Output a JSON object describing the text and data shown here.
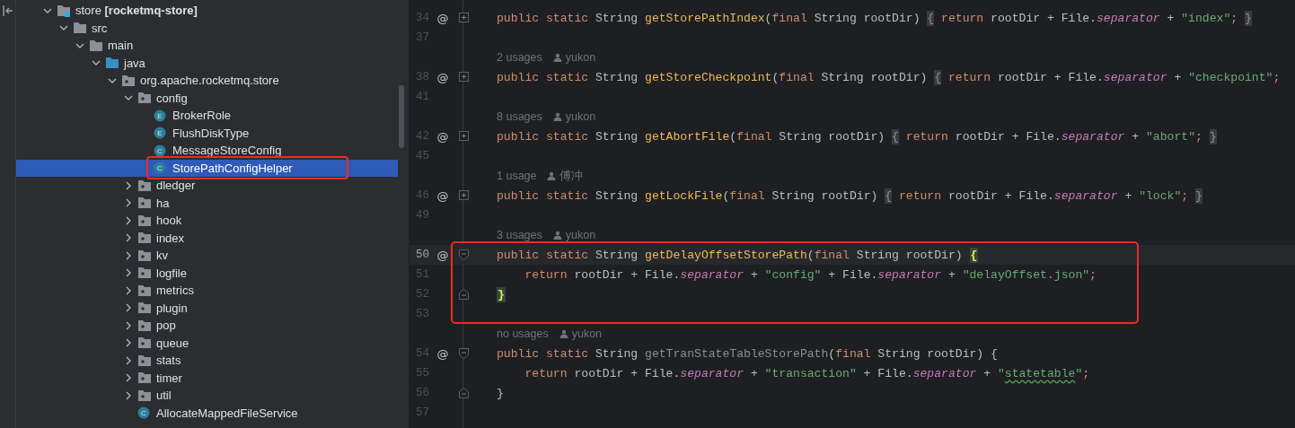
{
  "project_tree": {
    "items": [
      {
        "label": "store **[rocketmq-store]**",
        "kind": "module",
        "expanded": true,
        "selected": false,
        "children": [
          {
            "label": "src",
            "kind": "folder",
            "expanded": true,
            "selected": false,
            "children": [
              {
                "label": "main",
                "kind": "folder",
                "expanded": true,
                "selected": false,
                "children": [
                  {
                    "label": "java",
                    "kind": "source-folder",
                    "expanded": true,
                    "selected": false,
                    "children": [
                      {
                        "label": "org.apache.rocketmq.store",
                        "kind": "package",
                        "expanded": true,
                        "selected": false,
                        "children": [
                          {
                            "label": "config",
                            "kind": "package",
                            "expanded": true,
                            "selected": false,
                            "children": [
                              {
                                "label": "BrokerRole",
                                "icon_letter": "E",
                                "selected": false
                              },
                              {
                                "label": "FlushDiskType",
                                "icon_letter": "E",
                                "selected": false
                              },
                              {
                                "label": "MessageStoreConfig",
                                "icon_letter": "C",
                                "selected": false
                              },
                              {
                                "label": "StorePathConfigHelper",
                                "icon_letter": "C",
                                "selected": true,
                                "annotated": true
                              }
                            ]
                          },
                          {
                            "label": "dledger",
                            "kind": "package",
                            "expanded": false,
                            "selected": false
                          },
                          {
                            "label": "ha",
                            "kind": "package",
                            "expanded": false,
                            "selected": false
                          },
                          {
                            "label": "hook",
                            "kind": "package",
                            "expanded": false,
                            "selected": false
                          },
                          {
                            "label": "index",
                            "kind": "package",
                            "expanded": false,
                            "selected": false
                          },
                          {
                            "label": "kv",
                            "kind": "package",
                            "expanded": false,
                            "selected": false
                          },
                          {
                            "label": "logfile",
                            "kind": "package",
                            "expanded": false,
                            "selected": false
                          },
                          {
                            "label": "metrics",
                            "kind": "package",
                            "expanded": false,
                            "selected": false
                          },
                          {
                            "label": "plugin",
                            "kind": "package",
                            "expanded": false,
                            "selected": false
                          },
                          {
                            "label": "pop",
                            "kind": "package",
                            "expanded": false,
                            "selected": false
                          },
                          {
                            "label": "queue",
                            "kind": "package",
                            "expanded": false,
                            "selected": false
                          },
                          {
                            "label": "stats",
                            "kind": "package",
                            "expanded": false,
                            "selected": false
                          },
                          {
                            "label": "timer",
                            "kind": "package",
                            "expanded": false,
                            "selected": false
                          },
                          {
                            "label": "util",
                            "kind": "package",
                            "expanded": false,
                            "selected": false
                          },
                          {
                            "label": "AllocateMappedFileService",
                            "icon_letter": "C",
                            "selected": false
                          }
                        ]
                      }
                    ]
                  }
                ]
              }
            ]
          }
        ]
      }
    ]
  },
  "editor": {
    "lines": [
      {
        "kind": "line",
        "number": "34",
        "gutter_icon": "@",
        "folded": true,
        "tokens": [
          {
            "text": "public static ",
            "kind": "keyword"
          },
          {
            "text": "String ",
            "kind": "plain"
          },
          {
            "text": "getStorePathIndex",
            "kind": "method"
          },
          {
            "text": "(",
            "kind": "plain"
          },
          {
            "text": "final ",
            "kind": "keyword"
          },
          {
            "text": "String rootDir) ",
            "kind": "plain"
          },
          {
            "text": "{",
            "kind": "fold"
          },
          {
            "text": " return ",
            "kind": "keyword"
          },
          {
            "text": "rootDir + File.",
            "kind": "plain"
          },
          {
            "text": "separator",
            "kind": "field"
          },
          {
            "text": " + ",
            "kind": "plain"
          },
          {
            "text": "\"index\"",
            "kind": "string"
          },
          {
            "text": "; ",
            "kind": "punct"
          },
          {
            "text": "}",
            "kind": "fold"
          }
        ]
      },
      {
        "kind": "line",
        "number": "37"
      },
      {
        "kind": "hint",
        "usages": "2 usages",
        "author": "yukon"
      },
      {
        "kind": "line",
        "number": "38",
        "gutter_icon": "@",
        "folded": true,
        "tokens": [
          {
            "text": "public static ",
            "kind": "keyword"
          },
          {
            "text": "String ",
            "kind": "plain"
          },
          {
            "text": "getStoreCheckpoint",
            "kind": "method"
          },
          {
            "text": "(",
            "kind": "plain"
          },
          {
            "text": "final ",
            "kind": "keyword"
          },
          {
            "text": "String rootDir) ",
            "kind": "plain"
          },
          {
            "text": "{",
            "kind": "fold"
          },
          {
            "text": " return ",
            "kind": "keyword"
          },
          {
            "text": "rootDir + File.",
            "kind": "plain"
          },
          {
            "text": "separator",
            "kind": "field"
          },
          {
            "text": " + ",
            "kind": "plain"
          },
          {
            "text": "\"checkpoint\"",
            "kind": "string"
          },
          {
            "text": ";",
            "kind": "punct"
          }
        ]
      },
      {
        "kind": "line",
        "number": "41"
      },
      {
        "kind": "hint",
        "usages": "8 usages",
        "author": "yukon"
      },
      {
        "kind": "line",
        "number": "42",
        "gutter_icon": "@",
        "folded": true,
        "tokens": [
          {
            "text": "public static ",
            "kind": "keyword"
          },
          {
            "text": "String ",
            "kind": "plain"
          },
          {
            "text": "getAbortFile",
            "kind": "method"
          },
          {
            "text": "(",
            "kind": "plain"
          },
          {
            "text": "final ",
            "kind": "keyword"
          },
          {
            "text": "String rootDir) ",
            "kind": "plain"
          },
          {
            "text": "{",
            "kind": "fold"
          },
          {
            "text": " return ",
            "kind": "keyword"
          },
          {
            "text": "rootDir + File.",
            "kind": "plain"
          },
          {
            "text": "separator",
            "kind": "field"
          },
          {
            "text": " + ",
            "kind": "plain"
          },
          {
            "text": "\"abort\"",
            "kind": "string"
          },
          {
            "text": "; ",
            "kind": "punct"
          },
          {
            "text": "}",
            "kind": "fold"
          }
        ]
      },
      {
        "kind": "line",
        "number": "45"
      },
      {
        "kind": "hint",
        "usages": "1 usage",
        "author": "傅冲"
      },
      {
        "kind": "line",
        "number": "46",
        "gutter_icon": "@",
        "folded": true,
        "tokens": [
          {
            "text": "public static ",
            "kind": "keyword"
          },
          {
            "text": "String ",
            "kind": "plain"
          },
          {
            "text": "getLockFile",
            "kind": "method"
          },
          {
            "text": "(",
            "kind": "plain"
          },
          {
            "text": "final ",
            "kind": "keyword"
          },
          {
            "text": "String rootDir) ",
            "kind": "plain"
          },
          {
            "text": "{",
            "kind": "fold"
          },
          {
            "text": " return ",
            "kind": "keyword"
          },
          {
            "text": "rootDir + File.",
            "kind": "plain"
          },
          {
            "text": "separator",
            "kind": "field"
          },
          {
            "text": " + ",
            "kind": "plain"
          },
          {
            "text": "\"lock\"",
            "kind": "string"
          },
          {
            "text": "; ",
            "kind": "punct"
          },
          {
            "text": "}",
            "kind": "fold"
          }
        ]
      },
      {
        "kind": "line",
        "number": "49"
      },
      {
        "kind": "hint",
        "usages": "3 usages",
        "author": "yukon"
      },
      {
        "kind": "line",
        "number": "50",
        "gutter_icon": "@",
        "fold_start": true,
        "current": true,
        "annotated": true,
        "tokens": [
          {
            "text": "public static ",
            "kind": "keyword"
          },
          {
            "text": "String ",
            "kind": "plain"
          },
          {
            "text": "getDelayOffsetStorePath",
            "kind": "method"
          },
          {
            "text": "(",
            "kind": "plain"
          },
          {
            "text": "final ",
            "kind": "keyword"
          },
          {
            "text": "String rootDir) ",
            "kind": "plain"
          },
          {
            "text": "{",
            "kind": "brace-match"
          }
        ]
      },
      {
        "kind": "line",
        "number": "51",
        "annotated": true,
        "tokens": [
          {
            "text": "    return ",
            "kind": "keyword"
          },
          {
            "text": "rootDir + File.",
            "kind": "plain"
          },
          {
            "text": "separator",
            "kind": "field"
          },
          {
            "text": " + ",
            "kind": "plain"
          },
          {
            "text": "\"config\"",
            "kind": "string"
          },
          {
            "text": " + File.",
            "kind": "plain"
          },
          {
            "text": "separator",
            "kind": "field"
          },
          {
            "text": " + ",
            "kind": "plain"
          },
          {
            "text": "\"delayOffset.json\"",
            "kind": "string"
          },
          {
            "text": ";",
            "kind": "punct"
          }
        ]
      },
      {
        "kind": "line",
        "number": "52",
        "fold_end": true,
        "annotated": true,
        "tokens": [
          {
            "text": "}",
            "kind": "brace-match"
          }
        ]
      },
      {
        "kind": "line",
        "number": "53",
        "annotated": true
      },
      {
        "kind": "hint",
        "usages": "no usages",
        "author": "yukon"
      },
      {
        "kind": "line",
        "number": "54",
        "gutter_icon": "@",
        "fold_start": true,
        "tokens": [
          {
            "text": "public static ",
            "kind": "keyword"
          },
          {
            "text": "String ",
            "kind": "plain"
          },
          {
            "text": "getTranStateTableStorePath",
            "kind": "unused-method"
          },
          {
            "text": "(",
            "kind": "plain"
          },
          {
            "text": "final ",
            "kind": "keyword"
          },
          {
            "text": "String rootDir) {",
            "kind": "plain"
          }
        ]
      },
      {
        "kind": "line",
        "number": "55",
        "tokens": [
          {
            "text": "    return ",
            "kind": "keyword"
          },
          {
            "text": "rootDir + File.",
            "kind": "plain"
          },
          {
            "text": "separator",
            "kind": "field"
          },
          {
            "text": " + ",
            "kind": "plain"
          },
          {
            "text": "\"transaction\"",
            "kind": "string"
          },
          {
            "text": " + File.",
            "kind": "plain"
          },
          {
            "text": "separator",
            "kind": "field"
          },
          {
            "text": " + ",
            "kind": "plain"
          },
          {
            "text": "\"",
            "kind": "string"
          },
          {
            "text": "statetable",
            "kind": "typo"
          },
          {
            "text": "\"",
            "kind": "string"
          },
          {
            "text": ";",
            "kind": "punct"
          }
        ]
      },
      {
        "kind": "line",
        "number": "56",
        "fold_end": true,
        "tokens": [
          {
            "text": "}",
            "kind": "plain"
          }
        ]
      },
      {
        "kind": "line",
        "number": "57"
      }
    ]
  }
}
